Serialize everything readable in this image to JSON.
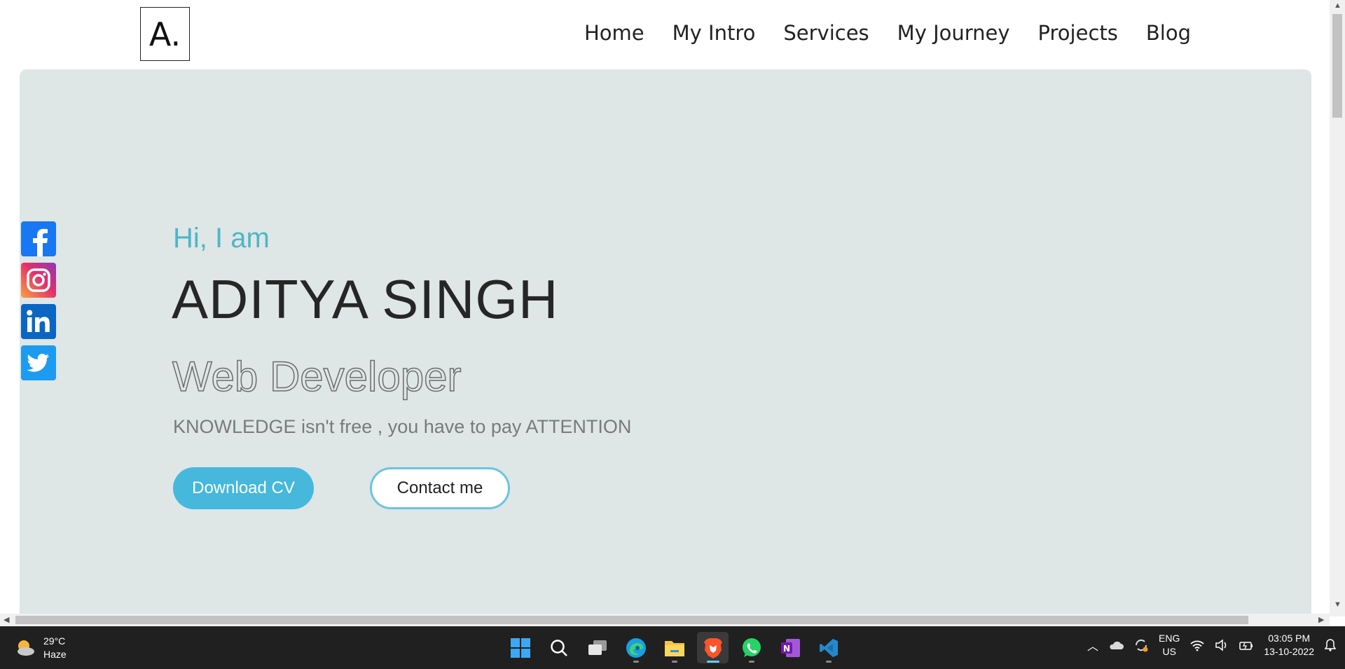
{
  "header": {
    "logo": "A.",
    "nav": [
      "Home",
      "My Intro",
      "Services",
      "My Journey",
      "Projects",
      "Blog"
    ]
  },
  "hero": {
    "greeting": "Hi, I am",
    "name": "ADITYA SINGH",
    "role": "Web Developer",
    "quote": "KNOWLEDGE isn't free , you have to pay ATTENTION",
    "download_label": "Download CV",
    "contact_label": "Contact me"
  },
  "social": [
    "facebook-icon",
    "instagram-icon",
    "linkedin-icon",
    "twitter-icon"
  ],
  "colors": {
    "accent": "#45b8dc",
    "greeting": "#4db6c6",
    "hero_bg": "#dee6e6",
    "taskbar": "#202020"
  },
  "taskbar": {
    "weather": {
      "temp": "29°C",
      "condition": "Haze"
    },
    "apps": [
      "windows-start-icon",
      "search-icon",
      "task-view-icon",
      "edge-icon",
      "file-explorer-icon",
      "brave-icon",
      "whatsapp-icon",
      "onenote-icon",
      "vscode-icon"
    ],
    "language": {
      "line1": "ENG",
      "line2": "US"
    },
    "clock": {
      "time": "03:05 PM",
      "date": "13-10-2022"
    }
  }
}
